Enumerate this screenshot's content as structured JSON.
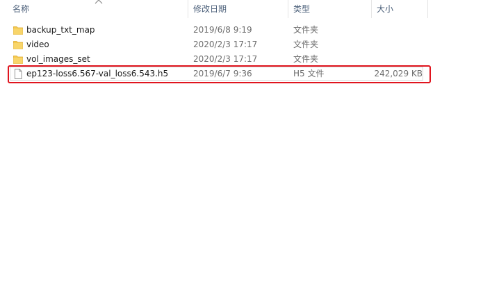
{
  "columns": {
    "name": "名称",
    "modified": "修改日期",
    "type": "类型",
    "size": "大小"
  },
  "files": [
    {
      "icon": "folder-icon",
      "name": "backup_txt_map",
      "modified": "2019/6/8 9:19",
      "type": "文件夹",
      "size": ""
    },
    {
      "icon": "folder-icon",
      "name": "video",
      "modified": "2020/2/3 17:17",
      "type": "文件夹",
      "size": ""
    },
    {
      "icon": "folder-icon",
      "name": "vol_images_set",
      "modified": "2020/2/3 17:17",
      "type": "文件夹",
      "size": ""
    },
    {
      "icon": "file-icon",
      "name": "ep123-loss6.567-val_loss6.543.h5",
      "modified": "2019/6/7 9:36",
      "type": "H5 文件",
      "size": "242,029 KB",
      "highlighted": true
    }
  ],
  "colors": {
    "highlight": "#e0141e",
    "folder": "#f5c84c",
    "header_text": "#4c607a"
  }
}
